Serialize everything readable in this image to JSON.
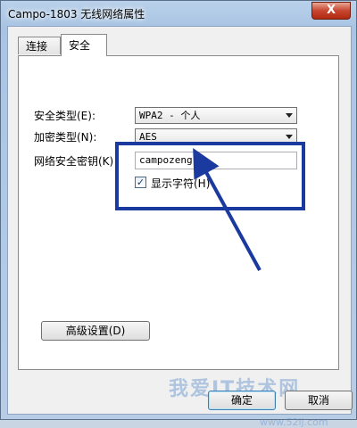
{
  "window": {
    "title": "Campo-1803 无线网络属性",
    "close_glyph": "X"
  },
  "tabs": [
    {
      "label": "连接"
    },
    {
      "label": "安全"
    }
  ],
  "security": {
    "type_label": "安全类型(E):",
    "type_value": "WPA2 - 个人",
    "encryption_label": "加密类型(N):",
    "encryption_value": "AES",
    "key_label": "网络安全密钥(K)",
    "key_value": "campozeng",
    "show_chars_label": "显示字符(H)",
    "show_chars_checked": true
  },
  "advanced_button": "高级设置(D)",
  "footer": {
    "ok_label": "确定",
    "cancel_label": "取消"
  },
  "annotation": {
    "highlight_color": "#1a3aa0"
  },
  "watermark": {
    "text": "我爱IT技术网",
    "sub": "www.52ij.com"
  }
}
